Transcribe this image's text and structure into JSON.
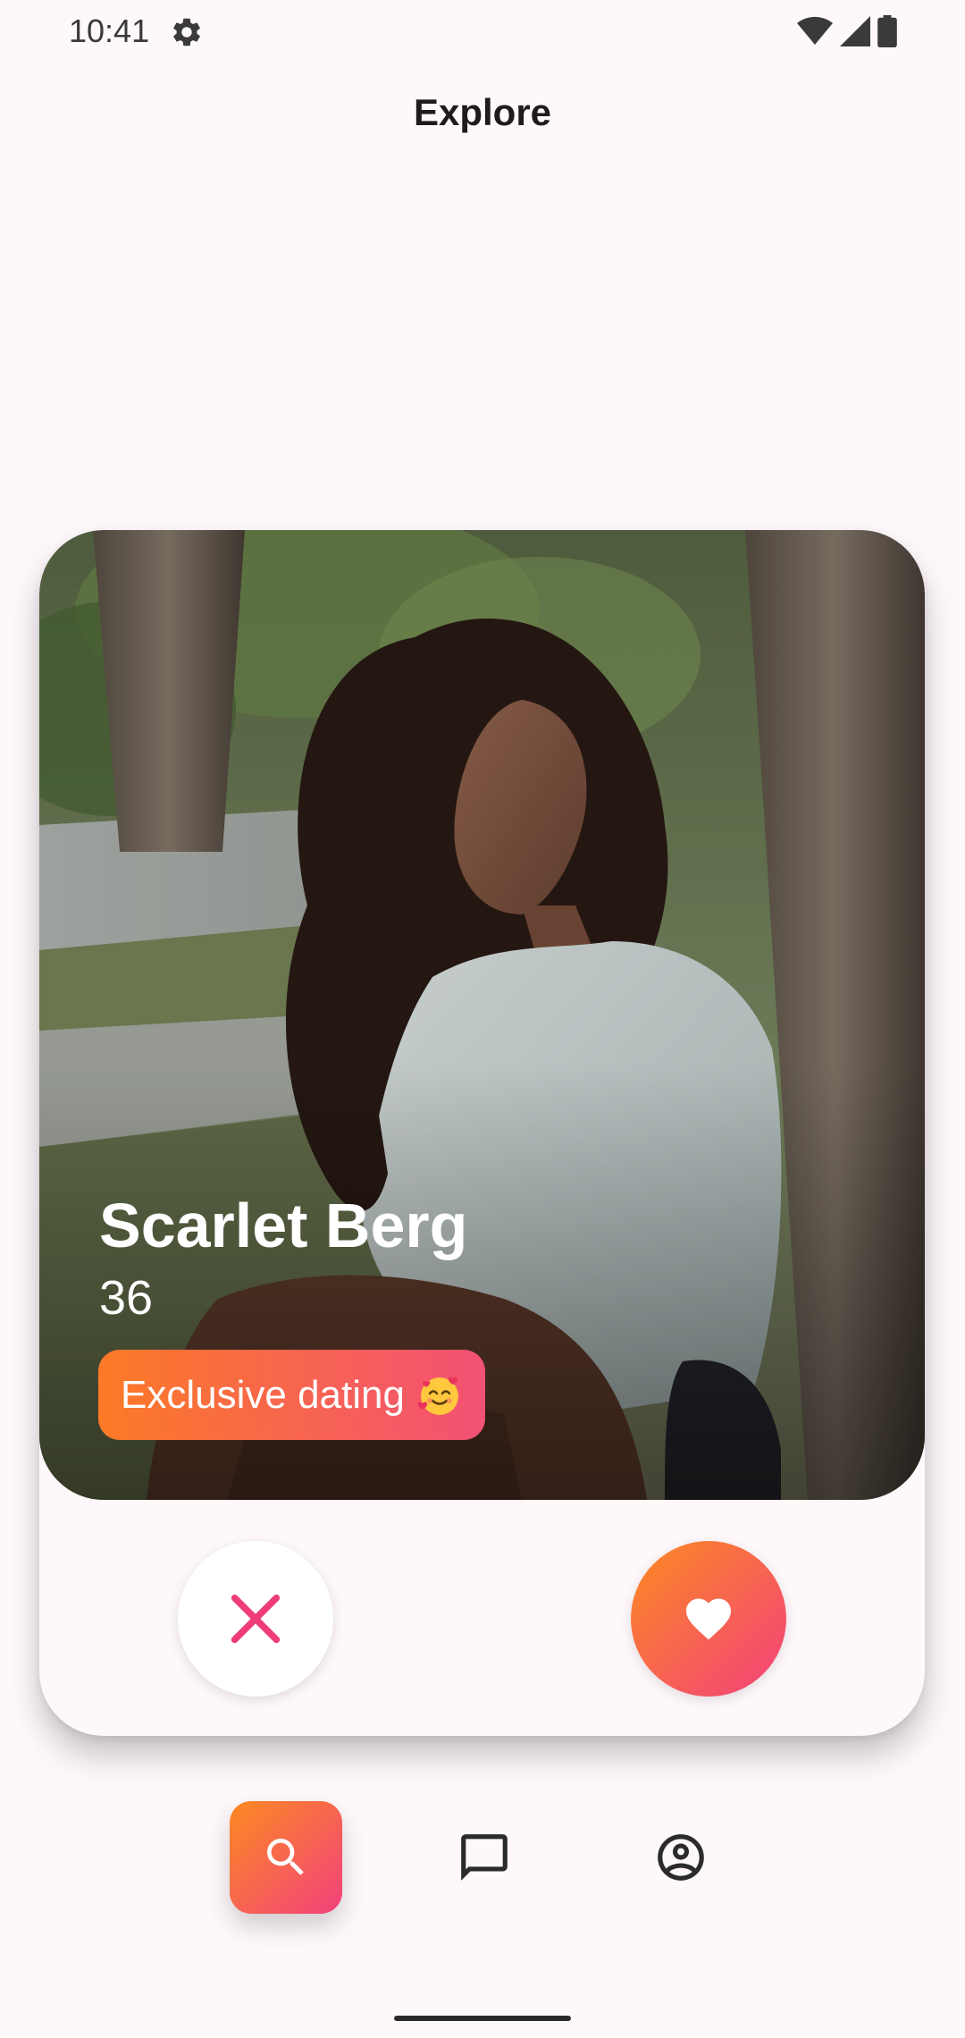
{
  "status_bar": {
    "time": "10:41",
    "icons": [
      "settings-icon",
      "wifi-icon",
      "signal-icon",
      "battery-icon"
    ]
  },
  "header": {
    "title": "Explore"
  },
  "profile": {
    "name": "Scarlet Berg",
    "age": "36",
    "badge_label": "Exclusive dating",
    "badge_emoji": "smiling-face-with-hearts-icon",
    "photo_alt": "profile-photo"
  },
  "actions": {
    "dislike_icon": "close-icon",
    "like_icon": "heart-icon"
  },
  "nav": {
    "items": [
      {
        "id": "explore",
        "icon": "search-icon",
        "active": true
      },
      {
        "id": "messages",
        "icon": "chat-icon",
        "active": false
      },
      {
        "id": "profile",
        "icon": "account-icon",
        "active": false
      }
    ]
  },
  "colors": {
    "background": "#fef8fb",
    "accent_start": "#fc7a27",
    "accent_end": "#f25175",
    "dislike_icon": "#ee3d79"
  }
}
